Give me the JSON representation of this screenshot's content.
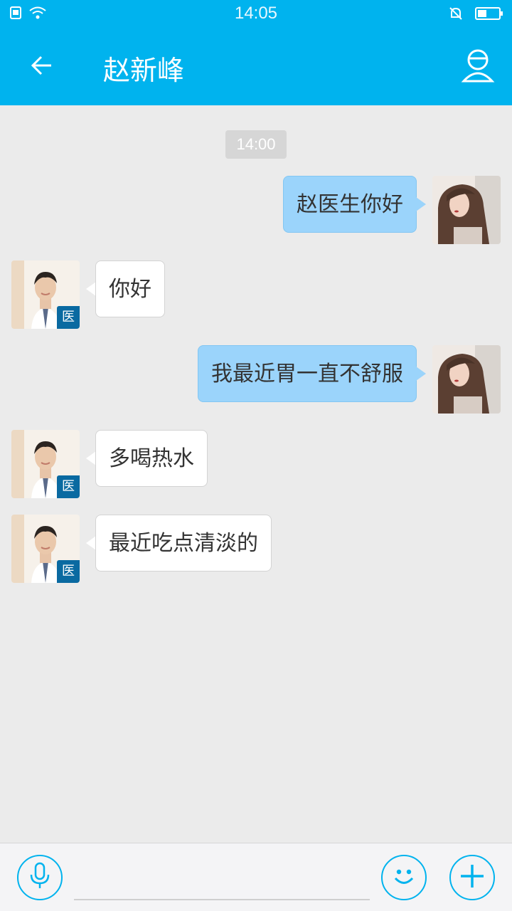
{
  "status_bar": {
    "time": "14:05"
  },
  "header": {
    "title": "赵新峰"
  },
  "chat": {
    "timestamp": "14:00",
    "messages": [
      {
        "from": "me",
        "text": "赵医生你好"
      },
      {
        "from": "doctor",
        "text": "你好",
        "badge": "医"
      },
      {
        "from": "me",
        "text": "我最近胃一直不舒服"
      },
      {
        "from": "doctor",
        "text": "多喝热水",
        "badge": "医"
      },
      {
        "from": "doctor",
        "text": "最近吃点清淡的",
        "badge": "医"
      }
    ]
  },
  "colors": {
    "brand": "#00b3ee",
    "my_bubble": "#9bd4fb",
    "doctor_badge": "#0a6aa1"
  },
  "icons": {
    "back": "arrow-left-icon",
    "profile": "user-icon",
    "mic": "mic-icon",
    "emoji": "smiley-icon",
    "plus": "plus-icon"
  }
}
